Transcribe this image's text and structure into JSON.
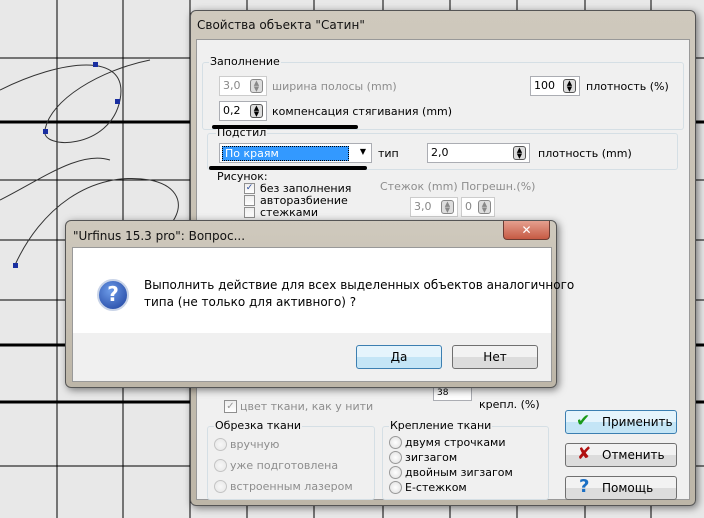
{
  "main_dialog": {
    "title": "Свойства объекта \"Сатин\"",
    "fill_group": {
      "label": "Заполнение",
      "width_value": "3,0",
      "width_label": "ширина полосы (mm)",
      "density_value": "100",
      "density_label": "плотность (%)",
      "comp_value": "0,2",
      "comp_label": "компенсация стягивания (mm)"
    },
    "underlay_group": {
      "label": "Подстил",
      "type_value": "По краям",
      "type_label": "тип",
      "density_value": "2,0",
      "density_label": "плотность (mm)"
    },
    "pattern": {
      "label": "Рисунок:",
      "checkboxes": [
        {
          "label": "без заполнения",
          "checked": true
        },
        {
          "label": "авторазбиение",
          "checked": false
        },
        {
          "label": "стежками",
          "checked": false
        }
      ],
      "col_header": "Стежок (mm) Погрешн.(%)",
      "stitch_value": "3,0",
      "error_value": "0"
    },
    "fabric_color": {
      "label": "цвет ткани, как у нити",
      "checked": true
    },
    "fix_percent": {
      "value": "38",
      "label": "крепл. (%)"
    },
    "trim_group": {
      "label": "Обрезка ткани",
      "options": [
        "вручную",
        "уже подготовлена",
        "встроенным лазером"
      ]
    },
    "fix_group": {
      "label": "Крепление ткани",
      "options": [
        "двумя строчками",
        "зигзагом",
        "двойным зигзагом",
        "E-стежком"
      ]
    },
    "buttons": {
      "apply": "Применить",
      "cancel": "Отменить",
      "help": "Помощь"
    }
  },
  "message_box": {
    "title": "\"Urfinus 15.3 pro\":  Вопрос...",
    "message_line1": "Выполнить действие для всех выделенных объектов аналогичного",
    "message_line2": "типа (не только для активного) ?",
    "yes": "Да",
    "no": "Нет",
    "close": "✕"
  }
}
